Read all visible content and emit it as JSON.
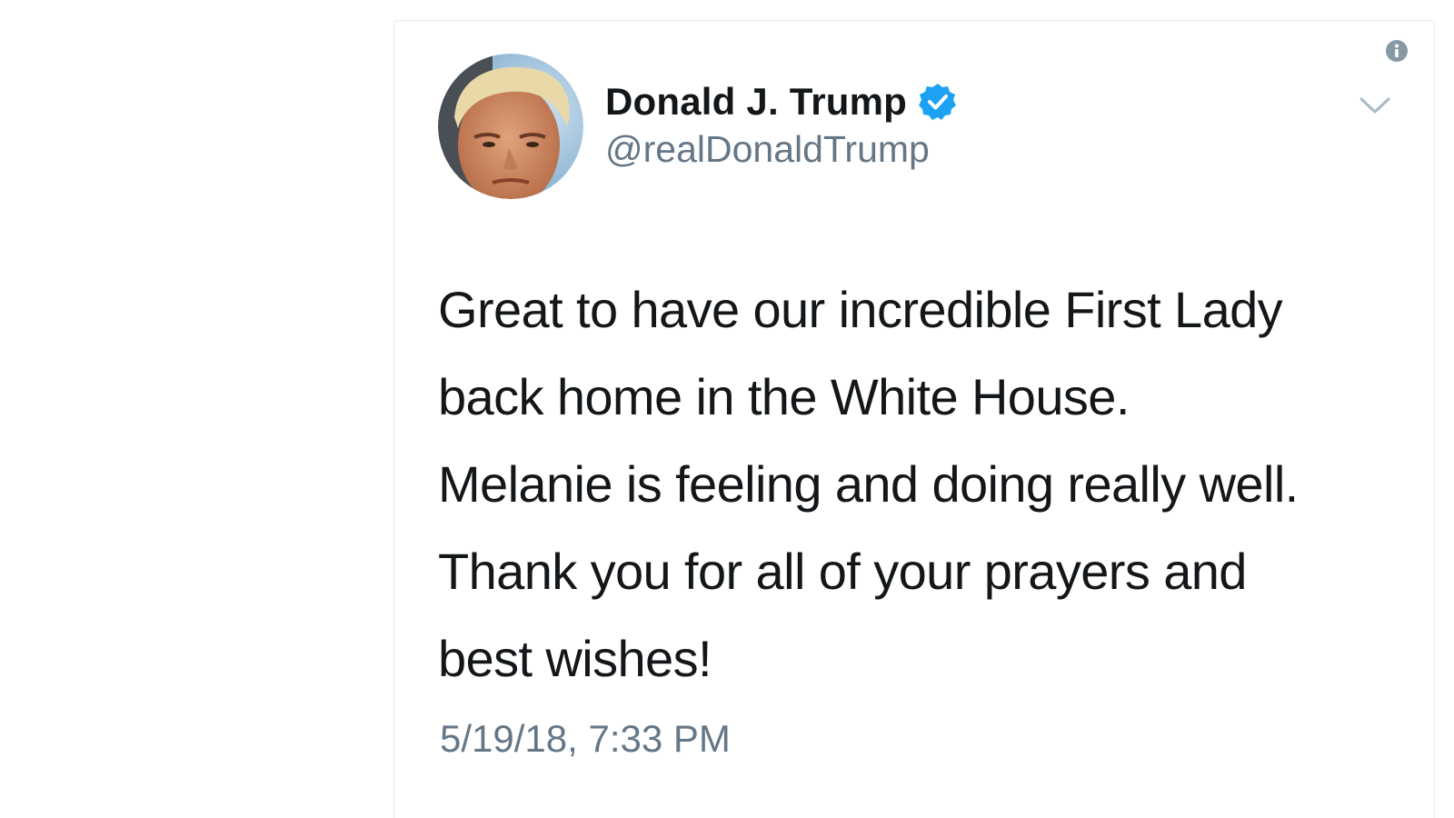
{
  "tweet": {
    "author": {
      "display_name": "Donald J. Trump",
      "handle": "@realDonaldTrump",
      "verified": true,
      "avatar_icon": "profile-photo",
      "verified_icon": "verified-badge-icon"
    },
    "text_lines": [
      "Great to have our incredible First Lady",
      "back home in the White House.",
      "Melanie is feeling and doing really well.",
      "Thank you for all of your prayers and",
      "best wishes!"
    ],
    "timestamp": "5/19/18, 7:33 PM",
    "menu_icon": "chevron-down-icon",
    "info_icon": "info-icon"
  },
  "colors": {
    "verified_blue": "#1da1f2",
    "text_primary": "#14171a",
    "text_secondary": "#657786",
    "border": "#e6ecf0"
  }
}
